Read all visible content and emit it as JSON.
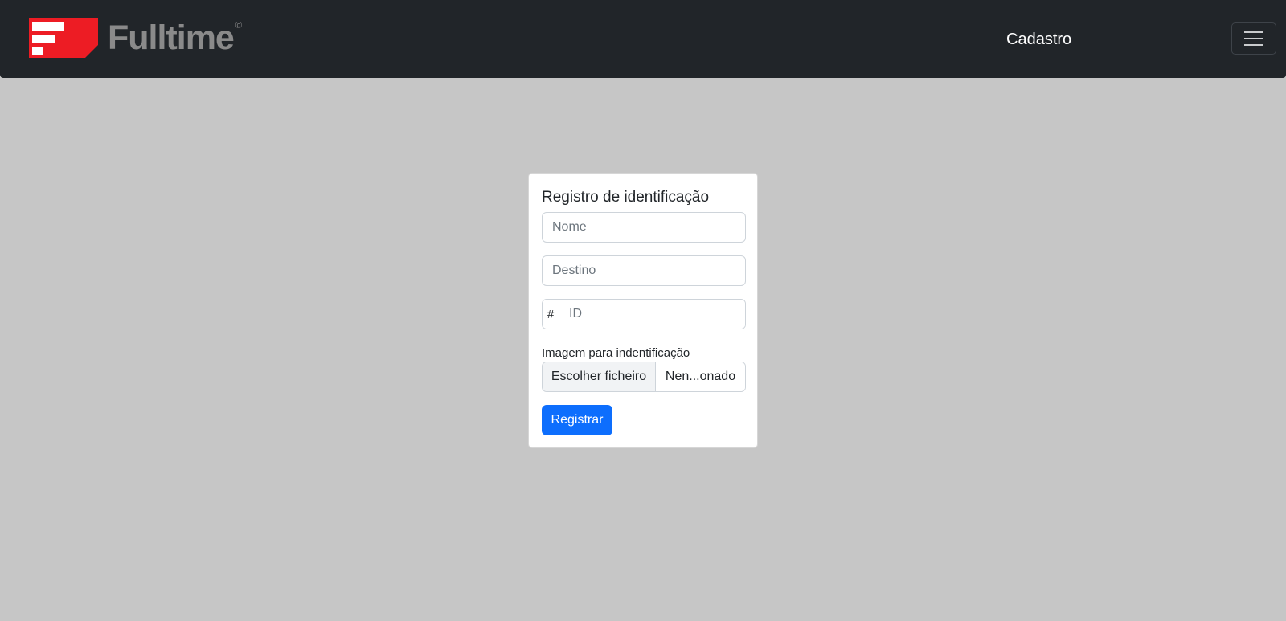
{
  "navbar": {
    "brand_name": "Fulltime",
    "brand_registered": "©",
    "brand_color": "#ed1c24",
    "nav_link": "Cadastro",
    "toggler_icon": "hamburger-menu-icon"
  },
  "card": {
    "title": "Registro de identificação",
    "nome_placeholder": "Nome",
    "destino_placeholder": "Destino",
    "id_prefix": "#",
    "id_placeholder": "ID",
    "file_label": "Imagem para indentificação",
    "file_button": "Escolher ficheiro",
    "file_status": "Nen...onado",
    "submit_label": "Registrar",
    "submit_color": "#0d6efd"
  }
}
